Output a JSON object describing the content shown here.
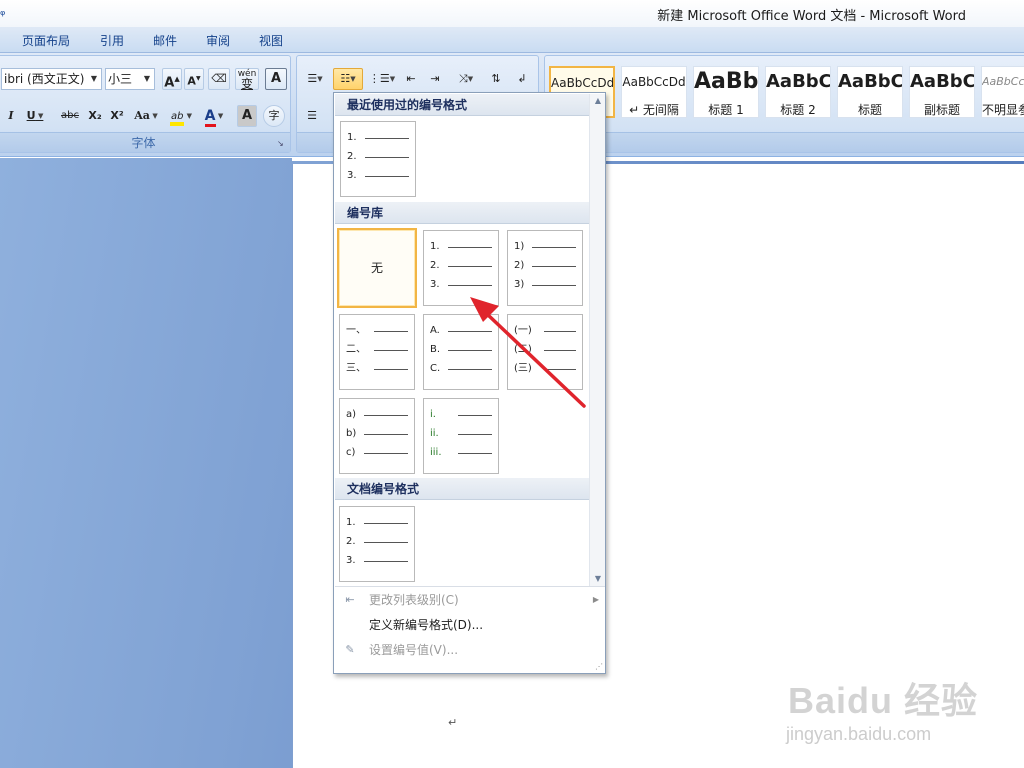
{
  "window": {
    "title": "新建 Microsoft Office Word 文档 - Microsoft Word"
  },
  "menu_tabs": [
    "页面布局",
    "引用",
    "邮件",
    "审阅",
    "视图"
  ],
  "font_group": {
    "font_name": "ibri (西文正文)",
    "font_size": "小三",
    "label": "字体",
    "grow_label": "A",
    "shrink_label": "A",
    "phonetic_label": "wén",
    "phonetic_char": "变",
    "border_char": "A",
    "italic": "I",
    "underline": "U",
    "strike": "abc",
    "subscript": "X₂",
    "superscript": "X²",
    "change_case": "Aa",
    "highlight": "ab",
    "font_color": "A",
    "char_shade": "A",
    "enclose": "字"
  },
  "styles": [
    {
      "preview": "AaBbCcDd",
      "name": ""
    },
    {
      "preview": "AaBbCcDd",
      "name": "↵ 无间隔"
    },
    {
      "preview": "AaBb",
      "name": "标题 1"
    },
    {
      "preview": "AaBbC",
      "name": "标题 2"
    },
    {
      "preview": "AaBbC",
      "name": "标题"
    },
    {
      "preview": "AaBbC",
      "name": "副标题"
    },
    {
      "preview": "AaBbCcDd",
      "name": "不明显参"
    }
  ],
  "numbering_menu": {
    "recent_header": "最近使用过的编号格式",
    "library_header": "编号库",
    "doc_header": "文档编号格式",
    "none_label": "无",
    "recent_tile": [
      "1.",
      "2.",
      "3."
    ],
    "library_tiles": [
      [
        "1.",
        "2.",
        "3."
      ],
      [
        "1)",
        "2)",
        "3)"
      ],
      [
        "一、",
        "二、",
        "三、"
      ],
      [
        "A.",
        "B.",
        "C."
      ],
      [
        "(一)",
        "(二)",
        "(三)"
      ],
      [
        "a)",
        "b)",
        "c)"
      ],
      [
        "i.",
        "ii.",
        "iii."
      ]
    ],
    "doc_tile": [
      "1.",
      "2.",
      "3."
    ],
    "commands": {
      "change_level": "更改列表级别(C)",
      "define_new": "定义新编号格式(D)...",
      "set_value": "设置编号值(V)..."
    }
  },
  "document": {
    "paragraph_mark": "↵"
  },
  "watermark": {
    "logo_text": "Baidu 经验",
    "url_text": "jingyan.baidu.com"
  },
  "colors": {
    "ribbon_text": "#15428b",
    "selection_border": "#f2b544",
    "arrow": "#e0242c",
    "font_color_bar": "#e3131b",
    "highlight_bar": "#ffe600"
  }
}
